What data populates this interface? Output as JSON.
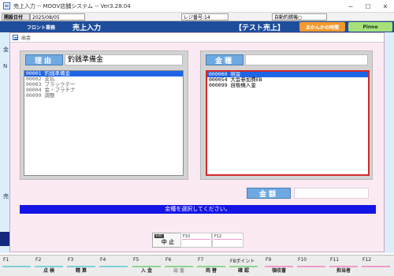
{
  "window": {
    "title": "売上入力 -- MOOV店舗システム -- Ver3.28.04",
    "minimize": "─",
    "maximize": "☐",
    "close": "✕"
  },
  "infobar": {
    "date_label": "開設日付",
    "date_value": "2025/08/05",
    "register_label": "レジ番号:14",
    "change_label": "自動釣銭機○"
  },
  "header": {
    "section": "フロント業務",
    "screen": "売上入力",
    "mode": "【テスト売上】",
    "orange_button": "あかんかの時間",
    "green_button": "Pinne"
  },
  "background": {
    "left_labels": [
      "金",
      "N",
      "売"
    ]
  },
  "dialog": {
    "title": "出金",
    "reason": {
      "label": "理由",
      "value": "釣銭準備金",
      "items": [
        {
          "text": "00001 釣銭準備金",
          "selected": true
        },
        {
          "text": "00002 支払",
          "selected": false
        },
        {
          "text": "00003 ブラックデー",
          "selected": false
        },
        {
          "text": "00004 金・プラチナ",
          "selected": false
        },
        {
          "text": "00099 調整",
          "selected": false
        }
      ]
    },
    "kind": {
      "label": "金種",
      "value": "",
      "items": [
        {
          "text": "000000 現金",
          "selected": true
        },
        {
          "text": "000054 大会参加費EB",
          "selected": false
        },
        {
          "text": "000099 自販機入金",
          "selected": false
        }
      ]
    },
    "amount": {
      "label": "金額",
      "value": ""
    },
    "message": "金種を選択してください。",
    "keys": [
      {
        "top": "Esc",
        "label": "中 止"
      },
      {
        "top": "F10",
        "label": ""
      },
      {
        "top": "F12",
        "label": ""
      }
    ]
  },
  "fkeys": [
    {
      "num": "F1",
      "label": "",
      "color": "#7fd1d8"
    },
    {
      "num": "F2",
      "label": "点 検",
      "color": "#7fd1d8"
    },
    {
      "num": "F3",
      "label": "精 算",
      "color": "#7fd1d8"
    },
    {
      "num": "F4",
      "label": "",
      "color": "#7fd1d8"
    },
    {
      "num": "F5",
      "label": "入 金",
      "color": "#8fd68f"
    },
    {
      "num": "F6",
      "label": "出 金",
      "color": "#8fd68f"
    },
    {
      "num": "F7",
      "label": "両 替",
      "color": "#8fd68f"
    },
    {
      "num": "F8ポイント",
      "label": "確 認",
      "color": "#8fd68f"
    },
    {
      "num": "F9",
      "label": "領収書",
      "color": "#f19acb"
    },
    {
      "num": "F10",
      "label": "",
      "color": "#f19acb"
    },
    {
      "num": "F11",
      "label": "担当者",
      "color": "#f19acb"
    },
    {
      "num": "F12",
      "label": "",
      "color": "#f19acb"
    }
  ]
}
